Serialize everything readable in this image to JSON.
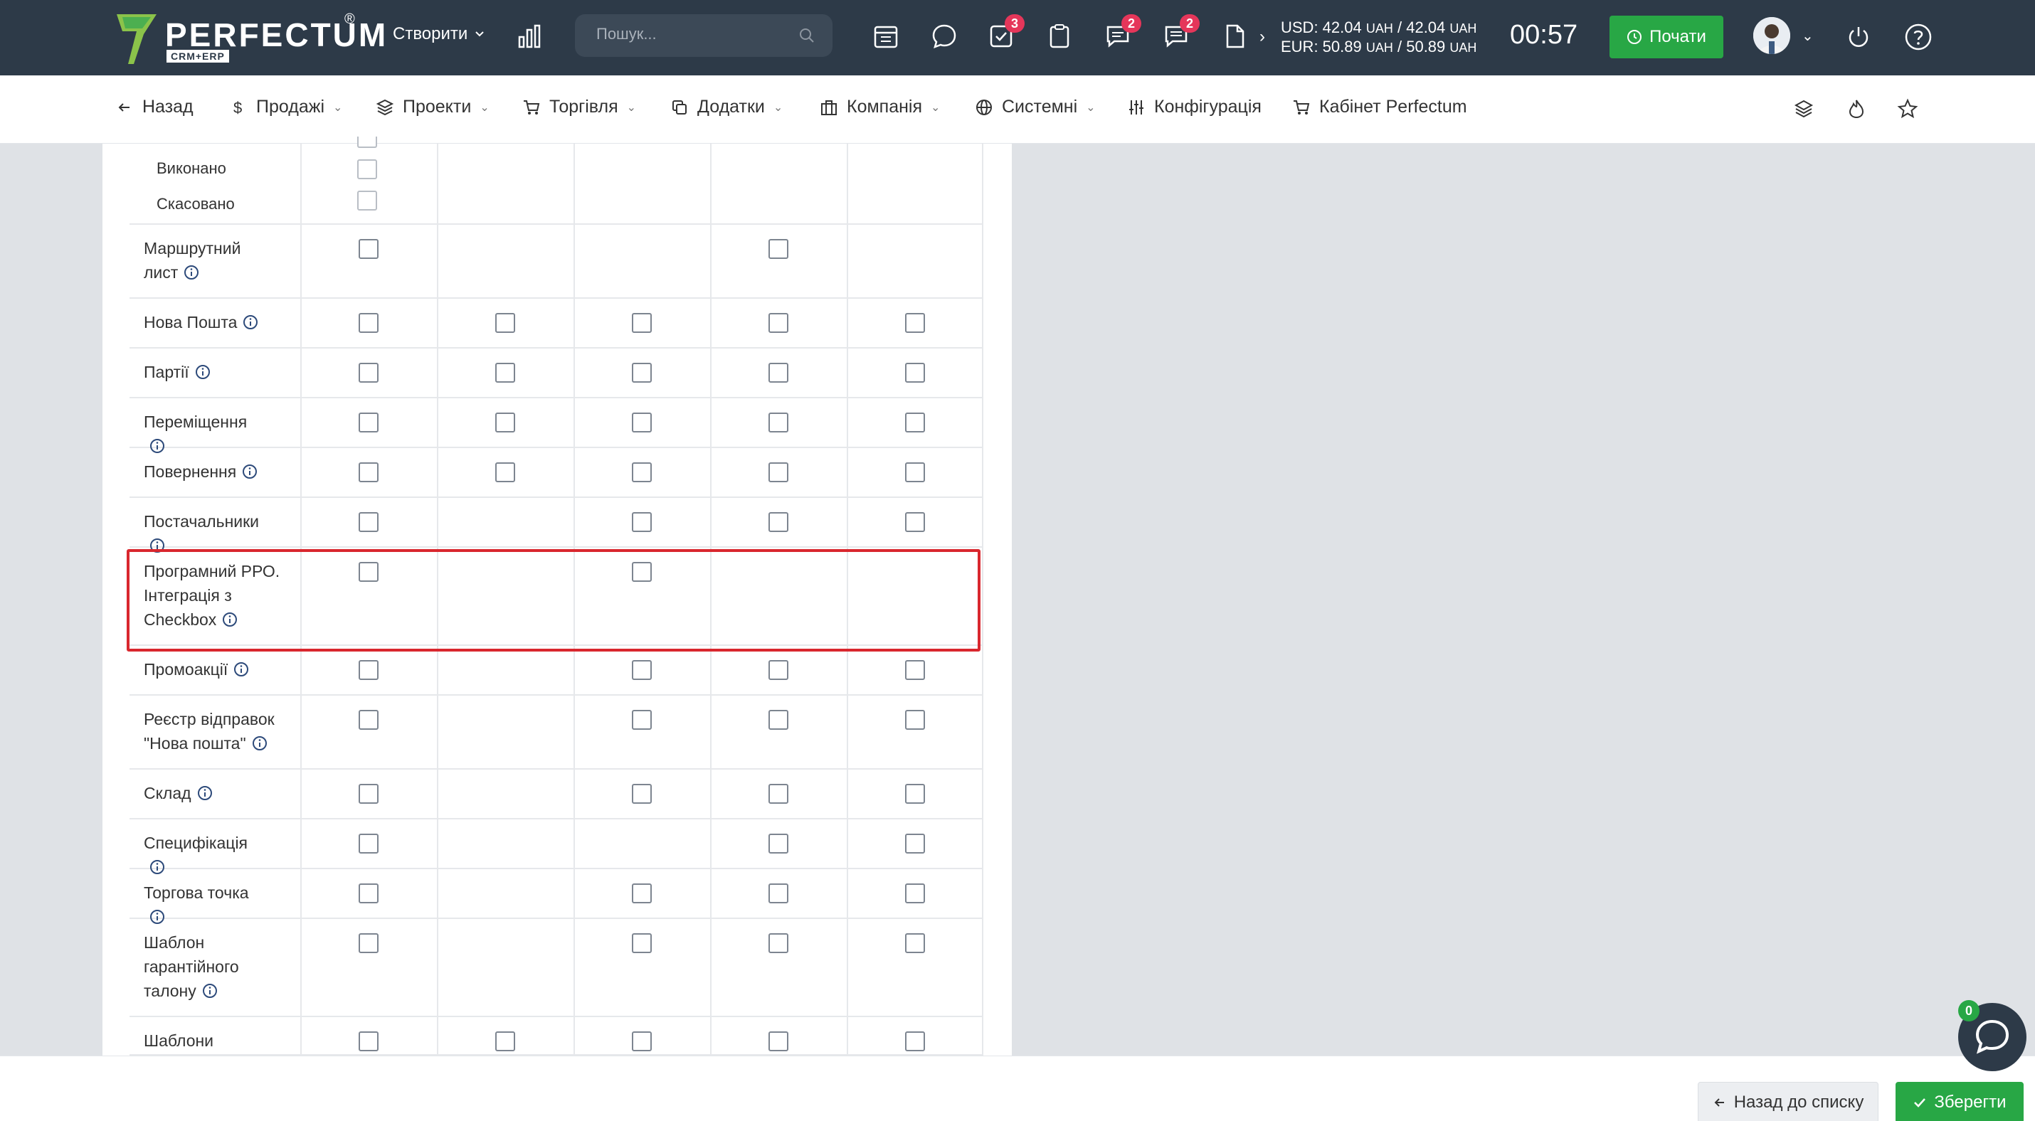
{
  "topbar": {
    "logo_text": "PERFECTUM",
    "logo_reg": "®",
    "logo_sub": "CRM+ERP",
    "create_label": "Створити",
    "search_placeholder": "Пошук...",
    "badges": {
      "tasks": "3",
      "messages": "2",
      "chats": "2"
    },
    "usd_label": "USD: 42.04",
    "usd_unit1": "UAH",
    "usd_sep": "/ 42.04",
    "usd_unit2": "UAH",
    "eur_label": "EUR: 50.89",
    "eur_unit1": "UAH",
    "eur_sep": "/ 50.89",
    "eur_unit2": "UAH",
    "timer": "00:57",
    "start_label": "Почати"
  },
  "nav": {
    "back": "Назад",
    "sales": "Продажі",
    "projects": "Проекти",
    "trade": "Торгівля",
    "addons": "Додатки",
    "company": "Компанія",
    "system": "Системні",
    "config": "Конфігурація",
    "cabinet": "Кабінет Perfectum"
  },
  "table": {
    "sub_rows": [
      "Виконано",
      "Скасовано"
    ],
    "rows": [
      {
        "label": "Маршрутний лист"
      },
      {
        "label": "Нова Пошта"
      },
      {
        "label": "Партії"
      },
      {
        "label": "Переміщення"
      },
      {
        "label": "Повернення"
      },
      {
        "label": "Постачальники"
      },
      {
        "label": "Програмний РРО. Інтеграція з Checkbox"
      },
      {
        "label": "Промоакції"
      },
      {
        "label": "Реєстр відправок \"Нова пошта\""
      },
      {
        "label": "Склад"
      },
      {
        "label": "Специфікація"
      },
      {
        "label": "Торгова точка"
      },
      {
        "label": "Шаблон гарантійного талону"
      },
      {
        "label": "Шаблони"
      }
    ]
  },
  "footer": {
    "back_to_list": "Назад до списку",
    "save": "Зберегти"
  },
  "chat": {
    "badge": "0"
  },
  "colors": {
    "topbar": "#2d3a48",
    "accent_green": "#28a745",
    "badge_red": "#e5365a",
    "highlight_red": "#d9272e"
  },
  "icons": [
    "calendar-icon",
    "chat-bubble-icon",
    "tasks-icon",
    "clipboard-icon",
    "messages-icon",
    "comments-icon",
    "document-icon",
    "power-icon",
    "help-icon",
    "layers-icon",
    "fire-icon",
    "star-icon",
    "info-icon"
  ]
}
